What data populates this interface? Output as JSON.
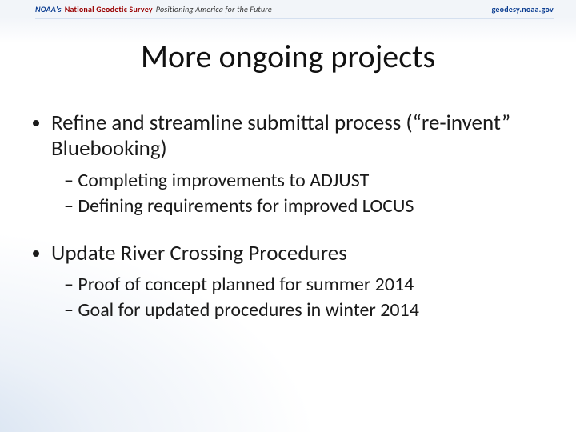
{
  "header": {
    "agency": "NOAA's",
    "program": "National Geodetic Survey",
    "tagline": "Positioning America for the Future",
    "url": "geodesy.noaa.gov"
  },
  "title": "More ongoing projects",
  "bullets": [
    {
      "text": "Refine and streamline submittal process (“re-invent” Bluebooking)",
      "sub": [
        "Completing improvements to ADJUST",
        "Defining requirements for improved LOCUS"
      ]
    },
    {
      "text": "Update River Crossing Procedures",
      "sub": [
        "Proof of concept planned for summer 2014",
        "Goal for updated procedures in winter 2014"
      ]
    }
  ]
}
